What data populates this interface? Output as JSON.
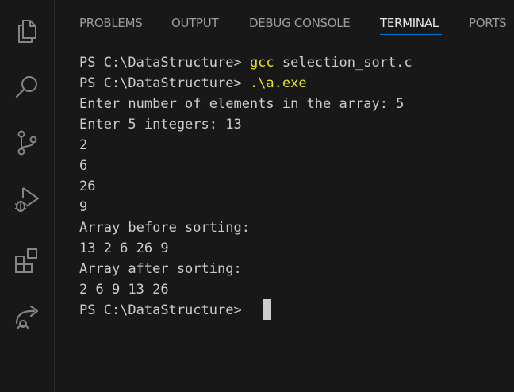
{
  "activity_bar": {
    "icons": [
      "explorer-icon",
      "search-icon",
      "source-control-icon",
      "run-debug-icon",
      "extensions-icon",
      "remote-share-icon"
    ]
  },
  "panel_tabs": [
    {
      "label": "PROBLEMS",
      "active": false
    },
    {
      "label": "OUTPUT",
      "active": false
    },
    {
      "label": "DEBUG CONSOLE",
      "active": false
    },
    {
      "label": "TERMINAL",
      "active": true
    },
    {
      "label": "PORTS",
      "active": false
    }
  ],
  "terminal": {
    "prompt": "PS C:\\DataStructure> ",
    "line1_cmd": "gcc",
    "line1_arg": " selection_sort.c",
    "line2_cmd": ".\\a.exe",
    "output": [
      "Enter number of elements in the array: 5",
      "Enter 5 integers: 13",
      "2",
      "6",
      "26",
      "9",
      "Array before sorting:",
      "13 2 6 26 9",
      "Array after sorting:",
      "2 6 9 13 26"
    ],
    "final_prompt": "PS C:\\DataStructure> "
  },
  "colors": {
    "background": "#181818",
    "text": "#cccccc",
    "command": "#e5e510",
    "tab_active": "#e7e7e7",
    "tab_inactive": "#9d9d9d",
    "accent": "#0078d4",
    "icon": "#858585"
  }
}
